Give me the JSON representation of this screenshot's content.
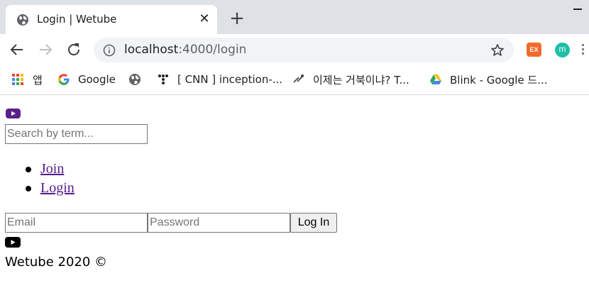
{
  "browser": {
    "tab": {
      "title": "Login | Wetube",
      "close_glyph": "✕",
      "icon": "globe-icon"
    },
    "new_tab_glyph": "+",
    "address": {
      "host": "localhost",
      "rest": ":4000/login"
    },
    "extensions": {
      "ex_label": "EX",
      "m_label": "m"
    },
    "bookmarks": [
      {
        "label": "앱",
        "icon": "apps-icon"
      },
      {
        "label": "Google",
        "icon": "google-icon"
      },
      {
        "label": "",
        "icon": "globe-icon"
      },
      {
        "label": "[ CNN ] inception-...",
        "icon": "dots-icon"
      },
      {
        "label": "이제는 거북이냐? T...",
        "icon": "bug-icon"
      },
      {
        "label": "Blink - Google 드...",
        "icon": "google-drive-icon"
      }
    ]
  },
  "page": {
    "search": {
      "placeholder": "Search by term..."
    },
    "nav": [
      {
        "label": "Join"
      },
      {
        "label": "Login"
      }
    ],
    "login_form": {
      "email_placeholder": "Email",
      "password_placeholder": "Password",
      "submit_label": "Log In"
    },
    "footer": {
      "text": "Wetube 2020 ©"
    }
  },
  "colors": {
    "logo_header": "#5b1f8a",
    "logo_footer": "#000000",
    "visited_link": "#551a8b"
  }
}
